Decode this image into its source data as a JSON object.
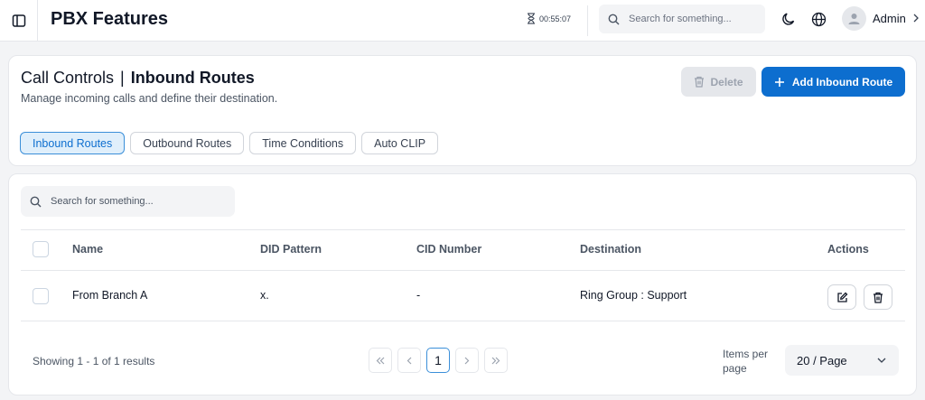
{
  "topbar": {
    "title": "PBX Features",
    "timer": "00:55:07",
    "search_placeholder": "Search for something...",
    "user_name": "Admin"
  },
  "header": {
    "breadcrumb_parent": "Call Controls",
    "breadcrumb_separator": "|",
    "breadcrumb_current": "Inbound Routes",
    "subtitle": "Manage incoming calls and define their destination.",
    "delete_label": "Delete",
    "add_label": "Add Inbound Route",
    "accent_color": "#0d6ecf",
    "tabs": [
      {
        "label": "Inbound Routes",
        "active": true
      },
      {
        "label": "Outbound Routes",
        "active": false
      },
      {
        "label": "Time Conditions",
        "active": false
      },
      {
        "label": "Auto CLIP",
        "active": false
      }
    ]
  },
  "table": {
    "search_placeholder": "Search for something...",
    "columns": {
      "name": "Name",
      "did": "DID Pattern",
      "cid": "CID Number",
      "destination": "Destination",
      "actions": "Actions"
    },
    "rows": [
      {
        "name": "From Branch A",
        "did": "x.",
        "cid": "-",
        "destination": "Ring Group : Support"
      }
    ]
  },
  "footer": {
    "showing": "Showing 1 - 1 of 1 results",
    "current_page": "1",
    "items_per_page_label": "Items per page",
    "items_per_page_value": "20 / Page"
  }
}
